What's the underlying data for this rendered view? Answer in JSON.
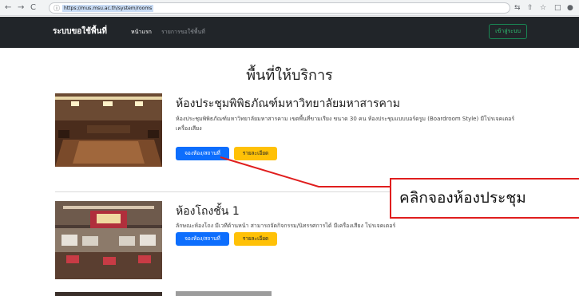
{
  "browser": {
    "url": "https://mus.msu.ac.th/system/rooms",
    "icons": [
      "back-arrow-icon",
      "forward-arrow-icon",
      "reload-icon",
      "lock-icon",
      "translate-icon",
      "share-icon",
      "star-icon",
      "window-icon",
      "profile-icon"
    ]
  },
  "navbar": {
    "brand": "ระบบขอใช้พื้นที่",
    "links": [
      {
        "label": "หน้าแรก",
        "active": true
      },
      {
        "label": "รายการขอใช้พื้นที่",
        "active": false
      }
    ],
    "login_label": "เข้าสู่ระบบ"
  },
  "page": {
    "heading": "พื้นที่ให้บริการ"
  },
  "rooms": [
    {
      "title": "ห้องประชุมพิพิธภัณฑ์มหาวิทยาลัยมหาสารคาม",
      "description": "ห้องประชุมพิพิธภัณฑ์มหาวิทยาลัยมหาสารคาม เขตพื้นที่ขามเรียง ขนาด 30 คน ห้องประชุมแบบบอร์ดรูม (Boardroom Style) มีโปรเจคเตอร์ เครื่องเสียง",
      "book_label": "จองห้อง/สถานที่",
      "detail_label": "รายละเอียด"
    },
    {
      "title": "ห้องโถงชั้น 1",
      "description": "ลักษณะห้องโถง มีเวทีด้านหน้า สามารถจัดกิจกรรม/นิทรรศการได้ มีเครื่องเสียง โปรเจคเตอร์",
      "book_label": "จองห้อง/สถานที่",
      "detail_label": "รายละเอียด"
    }
  ],
  "annotation": {
    "text": "คลิกจองห้องประชุม",
    "color": "#e01e1e"
  },
  "colors": {
    "navbar": "#212529",
    "primary": "#0d6efd",
    "warning": "#ffc107",
    "success": "#198754"
  }
}
